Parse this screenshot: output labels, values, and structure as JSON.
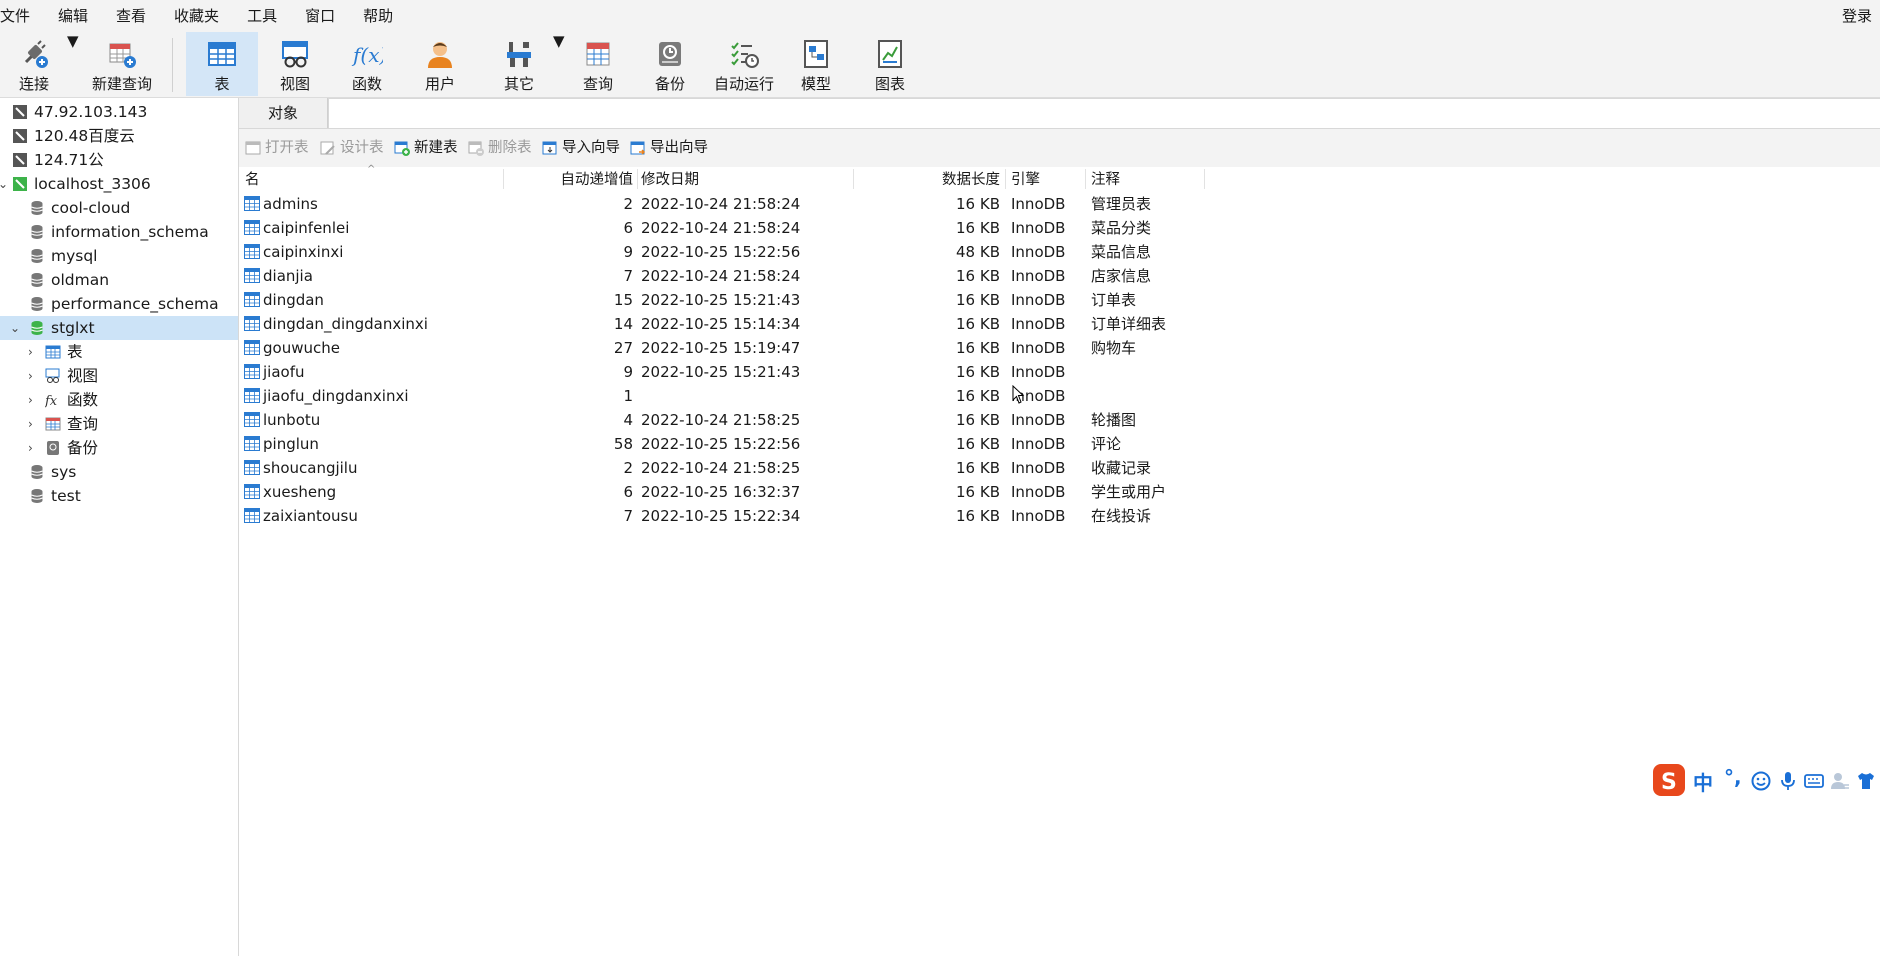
{
  "menu": {
    "items": [
      "文件",
      "编辑",
      "查看",
      "收藏夹",
      "工具",
      "窗口",
      "帮助"
    ],
    "login": "登录"
  },
  "toolbar": {
    "connect": "连接",
    "new_query": "新建查询",
    "table": "表",
    "view": "视图",
    "function": "函数",
    "user": "用户",
    "other": "其它",
    "query": "查询",
    "backup": "备份",
    "auto_run": "自动运行",
    "model": "模型",
    "chart": "图表"
  },
  "sidebar": {
    "connections": [
      {
        "label": "47.92.103.143"
      },
      {
        "label": "120.48百度云"
      },
      {
        "label": "124.71公"
      },
      {
        "label": "localhost_3306"
      }
    ],
    "databases": [
      {
        "label": "cool-cloud"
      },
      {
        "label": "information_schema"
      },
      {
        "label": "mysql"
      },
      {
        "label": "oldman"
      },
      {
        "label": "performance_schema"
      },
      {
        "label": "stglxt"
      }
    ],
    "children": [
      {
        "label": "表"
      },
      {
        "label": "视图"
      },
      {
        "label": "函数"
      },
      {
        "label": "查询"
      },
      {
        "label": "备份"
      }
    ],
    "more": [
      {
        "label": "sys"
      },
      {
        "label": "test"
      }
    ]
  },
  "tabs": {
    "objects": "对象"
  },
  "object_toolbar": {
    "open": "打开表",
    "design": "设计表",
    "new": "新建表",
    "delete": "删除表",
    "import": "导入向导",
    "export": "导出向导"
  },
  "table": {
    "headers": {
      "name": "名",
      "auto_inc": "自动递增值",
      "modified": "修改日期",
      "data_length": "数据长度",
      "engine": "引擎",
      "comment": "注释"
    },
    "rows": [
      {
        "name": "admins",
        "auto_inc": "2",
        "modified": "2022-10-24 21:58:24",
        "size": "16 KB",
        "engine": "InnoDB",
        "comment": "管理员表"
      },
      {
        "name": "caipinfenlei",
        "auto_inc": "6",
        "modified": "2022-10-24 21:58:24",
        "size": "16 KB",
        "engine": "InnoDB",
        "comment": "菜品分类"
      },
      {
        "name": "caipinxinxi",
        "auto_inc": "9",
        "modified": "2022-10-25 15:22:56",
        "size": "48 KB",
        "engine": "InnoDB",
        "comment": "菜品信息"
      },
      {
        "name": "dianjia",
        "auto_inc": "7",
        "modified": "2022-10-24 21:58:24",
        "size": "16 KB",
        "engine": "InnoDB",
        "comment": "店家信息"
      },
      {
        "name": "dingdan",
        "auto_inc": "15",
        "modified": "2022-10-25 15:21:43",
        "size": "16 KB",
        "engine": "InnoDB",
        "comment": "订单表"
      },
      {
        "name": "dingdan_dingdanxinxi",
        "auto_inc": "14",
        "modified": "2022-10-25 15:14:34",
        "size": "16 KB",
        "engine": "InnoDB",
        "comment": "订单详细表"
      },
      {
        "name": "gouwuche",
        "auto_inc": "27",
        "modified": "2022-10-25 15:19:47",
        "size": "16 KB",
        "engine": "InnoDB",
        "comment": "购物车"
      },
      {
        "name": "jiaofu",
        "auto_inc": "9",
        "modified": "2022-10-25 15:21:43",
        "size": "16 KB",
        "engine": "InnoDB",
        "comment": ""
      },
      {
        "name": "jiaofu_dingdanxinxi",
        "auto_inc": "1",
        "modified": "",
        "size": "16 KB",
        "engine": "InnoDB",
        "comment": ""
      },
      {
        "name": "lunbotu",
        "auto_inc": "4",
        "modified": "2022-10-24 21:58:25",
        "size": "16 KB",
        "engine": "InnoDB",
        "comment": "轮播图"
      },
      {
        "name": "pinglun",
        "auto_inc": "58",
        "modified": "2022-10-25 15:22:56",
        "size": "16 KB",
        "engine": "InnoDB",
        "comment": "评论"
      },
      {
        "name": "shoucangjilu",
        "auto_inc": "2",
        "modified": "2022-10-24 21:58:25",
        "size": "16 KB",
        "engine": "InnoDB",
        "comment": "收藏记录"
      },
      {
        "name": "xuesheng",
        "auto_inc": "6",
        "modified": "2022-10-25 16:32:37",
        "size": "16 KB",
        "engine": "InnoDB",
        "comment": "学生或用户"
      },
      {
        "name": "zaixiantousu",
        "auto_inc": "7",
        "modified": "2022-10-25 15:22:34",
        "size": "16 KB",
        "engine": "InnoDB",
        "comment": "在线投诉"
      }
    ]
  },
  "ime": {
    "mode": "中",
    "punct": "°,"
  },
  "colors": {
    "selected": "#cce3f7",
    "active_tool": "#d4e6f7",
    "accent": "#1a6fd6",
    "sogou": "#e8481c"
  }
}
